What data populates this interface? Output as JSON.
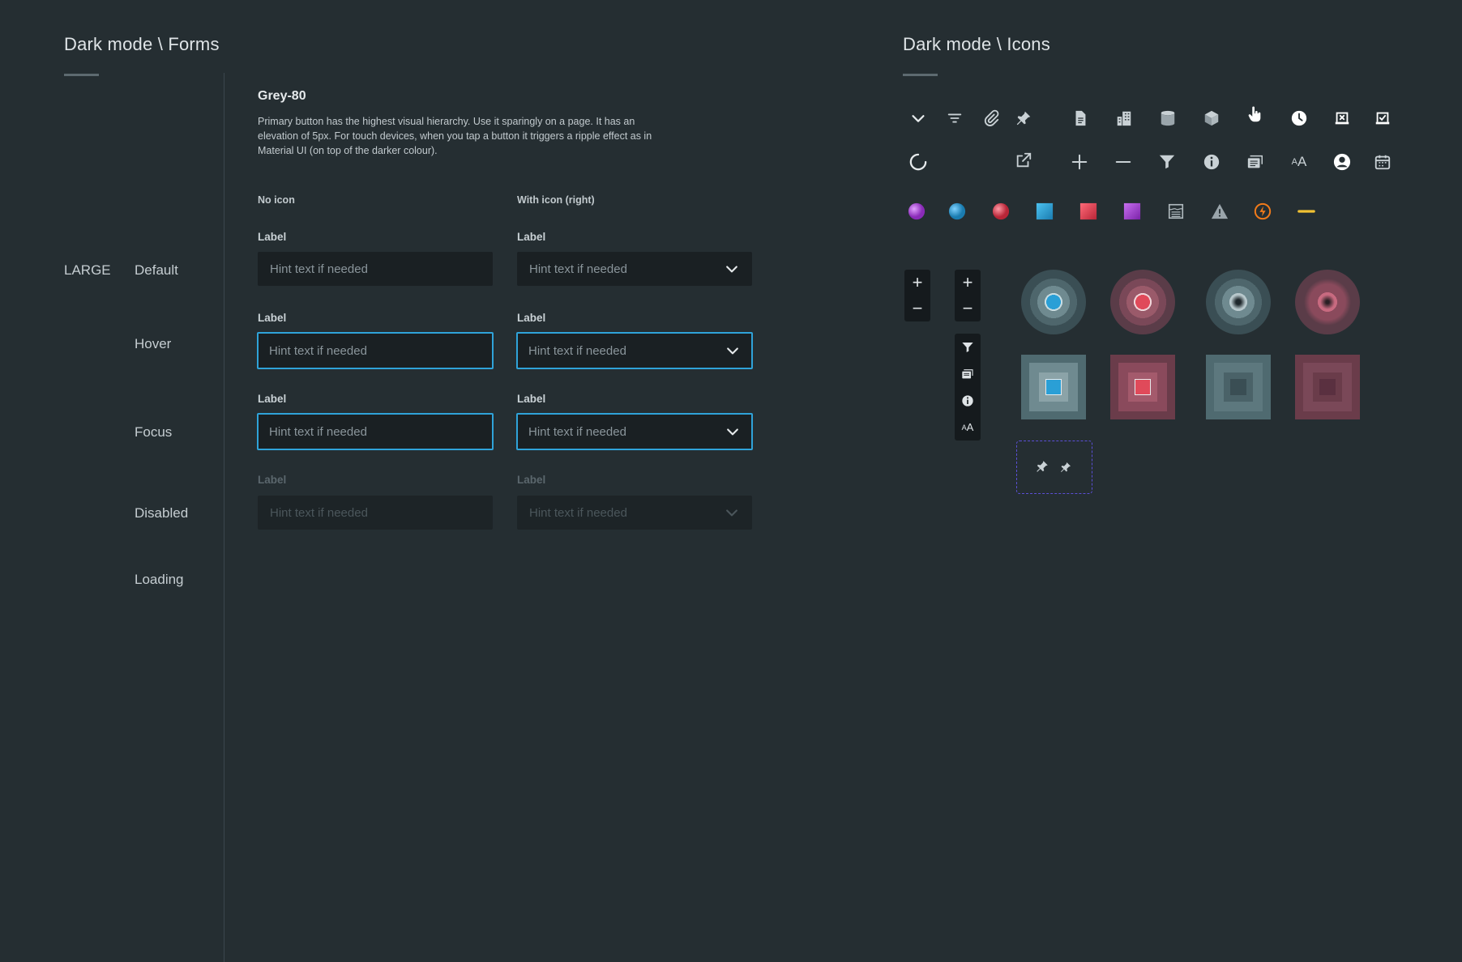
{
  "forms": {
    "title": "Dark mode \\ Forms",
    "size_label": "LARGE",
    "states": [
      "Default",
      "Hover",
      "Focus",
      "Disabled",
      "Loading"
    ],
    "swatch_title": "Grey-80",
    "description": "Primary button has the highest visual hierarchy. Use it sparingly on a page. It has an elevation of 5px. For touch devices, when you tap a button it triggers a ripple effect as in Material UI (on top of the darker colour).",
    "columns": [
      "No icon",
      "With icon (right)"
    ],
    "field_label": "Label",
    "hint": "Hint text if needed"
  },
  "icons": {
    "title": "Dark mode \\ Icons",
    "row1": [
      "chevron-down-icon",
      "filter-lines-icon",
      "paperclip-icon",
      "pin-icon",
      "document-icon",
      "buildings-icon",
      "cylinder-icon",
      "cube-icon",
      "hand-pointer-icon",
      "clock-icon",
      "tray-x-icon",
      "tray-check-icon"
    ],
    "row2": [
      "spinner-icon",
      "external-link-icon",
      "plus-icon",
      "minus-icon",
      "funnel-icon",
      "info-icon",
      "stack-cards-icon",
      "font-size-icon",
      "user-circle-icon",
      "calendar-icon"
    ],
    "row3": [
      "purple-sphere-icon",
      "blue-sphere-icon",
      "red-sphere-icon",
      "blue-square-icon",
      "red-square-icon",
      "purple-square-icon",
      "water-tank-icon",
      "warning-icon",
      "lightning-icon",
      "yellow-dash-icon"
    ],
    "font_size_glyph": "AA",
    "zoom_plus": "+",
    "zoom_minus": "−"
  },
  "colors": {
    "background": "#252e32",
    "field_bg": "#1a2023",
    "focus": "#2fa3d9",
    "purple_dashed": "#5b4fd6",
    "blue": "#2a9fd6",
    "red": "#e04a5a",
    "purple": "#a64ad0",
    "orange": "#f07a1a",
    "yellow": "#f2c233"
  }
}
